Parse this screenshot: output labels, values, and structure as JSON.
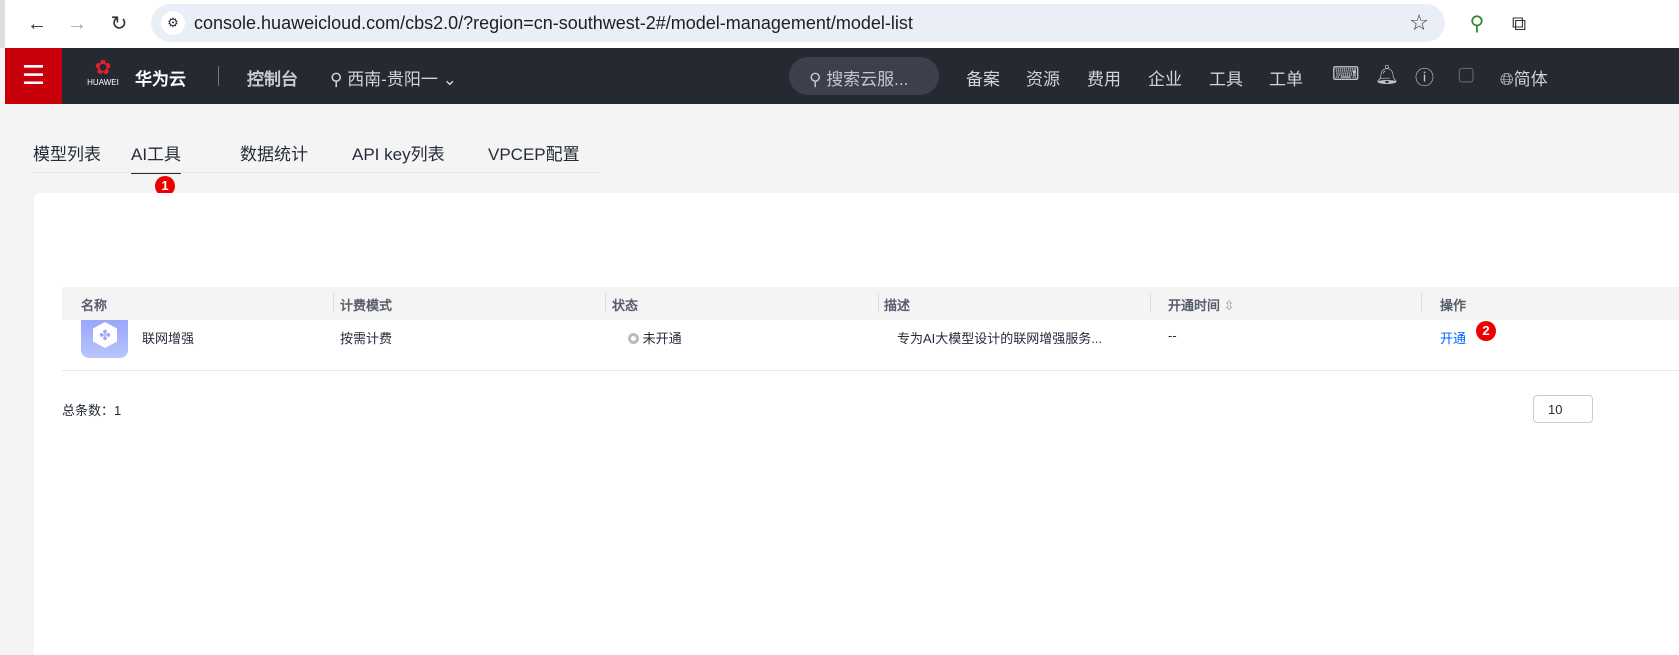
{
  "browser": {
    "url": "console.huaweicloud.com/cbs2.0/?region=cn-southwest-2#/model-management/model-list"
  },
  "topnav": {
    "logo_text": "HUAWEI",
    "brand": "华为云",
    "console": "控制台",
    "region": "西南-贵阳一",
    "search_placeholder": "搜索云服...",
    "links": [
      "备案",
      "资源",
      "费用",
      "企业",
      "工具",
      "工单"
    ],
    "language": "简体"
  },
  "tabs": [
    {
      "label": "模型列表"
    },
    {
      "label": "AI工具",
      "active": true
    },
    {
      "label": "数据统计"
    },
    {
      "label": "API key列表"
    },
    {
      "label": "VPCEP配置"
    }
  ],
  "badges": [
    "1",
    "2"
  ],
  "table": {
    "headers": [
      "名称",
      "计费模式",
      "状态",
      "描述",
      "开通时间",
      "操作"
    ],
    "rows": [
      {
        "name": "联网增强",
        "billing": "按需计费",
        "status": "未开通",
        "description": "专为AI大模型设计的联网增强服务...",
        "time": "--",
        "action": "开通"
      }
    ]
  },
  "footer": {
    "total": "总条数：1",
    "page_size": "10"
  },
  "colors": {
    "accent": "#c7000b",
    "link": "#0066ff",
    "nav_bg": "#252931"
  }
}
